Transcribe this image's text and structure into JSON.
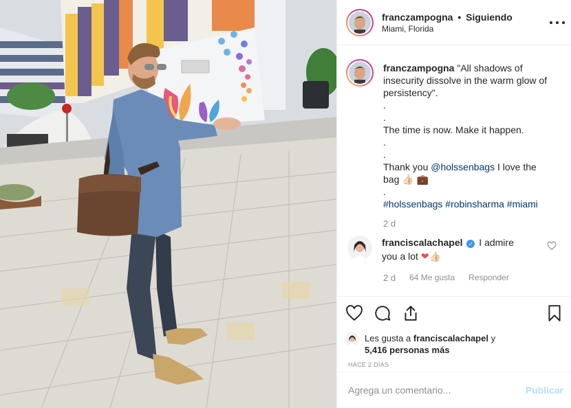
{
  "header": {
    "username": "franczampogna",
    "separator": "•",
    "follow_label": "Siguiendo",
    "location": "Miami, Florida"
  },
  "caption": {
    "username": "franczampogna",
    "lines": [
      "\"All shadows of insecurity dissolve in the warm glow of persistency\".",
      ".",
      ".",
      "The time is now. Make it happen.",
      ".",
      ".",
      "Thank you",
      ".",
      ""
    ],
    "thanks_mention": "@holssenbags",
    "thanks_rest": "I love the bag 👍🏻 💼",
    "hashtags": [
      "#holssenbags",
      "#robinsharma",
      "#miami"
    ],
    "age": "2 d"
  },
  "reply": {
    "username": "franciscalachapel",
    "verified_mark": "✓",
    "text": "I admire you a lot",
    "emoji": "❤👍🏻",
    "age": "2 d",
    "likes": "64 Me gusta",
    "reply_label": "Responder"
  },
  "likes": {
    "prefix": "Les gusta a",
    "user": "franciscalachapel",
    "suffix": "y",
    "count": "5,416 personas más"
  },
  "posted": "HACE 2 DÍAS",
  "comment_box": {
    "placeholder": "Agrega un comentario...",
    "publish_label": "Publicar"
  },
  "icons": {
    "more": "more-options-icon",
    "like": "heart-icon",
    "comment": "comment-bubble-icon",
    "share": "share-icon",
    "save": "bookmark-icon",
    "reply_like": "small-heart-icon"
  },
  "colors": {
    "link": "#00376b",
    "muted": "#8e8e8e",
    "verified": "#3897f0",
    "publish_disabled": "#b2dffc",
    "heart": "#ed4956"
  }
}
